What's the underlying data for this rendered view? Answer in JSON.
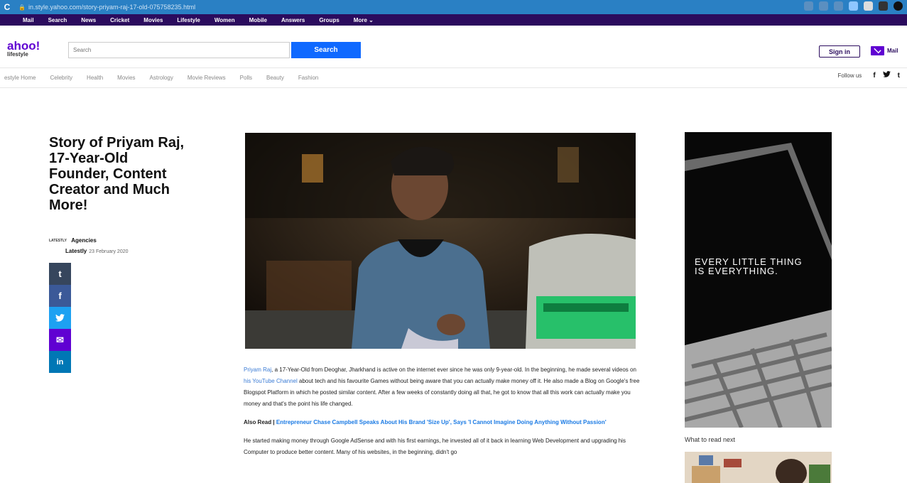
{
  "browser": {
    "url": "in.style.yahoo.com/story-priyam-raj-17-old-075758235.html",
    "reload_icon": "reload-icon",
    "lock_icon": "lock-icon"
  },
  "top_nav": [
    "Mail",
    "Search",
    "News",
    "Cricket",
    "Movies",
    "Lifestyle",
    "Women",
    "Mobile",
    "Answers",
    "Groups",
    "More ⌄"
  ],
  "header": {
    "logo": "ahoo!",
    "logo_sub": "lifestyle",
    "search_placeholder": "Search",
    "search_button": "Search",
    "sign_in": "Sign in",
    "mail": "Mail"
  },
  "section_nav": [
    "estyle Home",
    "Celebrity",
    "Health",
    "Movies",
    "Astrology",
    "Movie Reviews",
    "Polls",
    "Beauty",
    "Fashion"
  ],
  "follow": {
    "label": "Follow us",
    "icons": [
      "f",
      "𝕪",
      "t"
    ]
  },
  "article": {
    "title": "Story of Priyam Raj, 17-Year-Old Founder, Content Creator and Much More!",
    "source_logo": "LATESTLY",
    "author": "Agencies",
    "publisher": "Latestly",
    "date": "23 February 2020",
    "share": [
      {
        "name": "tumblr",
        "glyph": "t",
        "color": "#36465d"
      },
      {
        "name": "facebook",
        "glyph": "f",
        "color": "#3b5998"
      },
      {
        "name": "twitter",
        "glyph": "🐦",
        "color": "#1da1f2"
      },
      {
        "name": "mail",
        "glyph": "✉",
        "color": "#6001d2"
      },
      {
        "name": "linkedin",
        "glyph": "in",
        "color": "#0077b5"
      }
    ],
    "p1_link1": "Priyam Raj",
    "p1_text1": ", a 17-Year-Old from Deoghar, Jharkhand is active on the internet ever since he was only 9-year-old. In the beginning, he made several videos on ",
    "p1_link2": "his YouTube Channel",
    "p1_text2": " about tech and his favourite Games without being aware that you can actually make money off it. He also made a Blog on Google's free Blogspot Platform in which he posted similar content. After a few weeks of constantly doing all that, he got to know that all this work can actually make you money and that's the point his life changed.",
    "also_read_prefix": "Also Read | ",
    "also_read_link": "Entrepreneur Chase Campbell Speaks About His Brand 'Size Up', Says 'I Cannot Imagine Doing Anything Without Passion'",
    "p2": "He started making money through Google AdSense and with his first earnings, he invested all of it back in learning Web Development and upgrading his Computer to produce better content. Many of his websites, in the beginning, didn't go"
  },
  "ad": {
    "text": "EVERY LITTLE THING\nIS EVERYTHING."
  },
  "sidebar": {
    "what_next": "What to read next"
  }
}
